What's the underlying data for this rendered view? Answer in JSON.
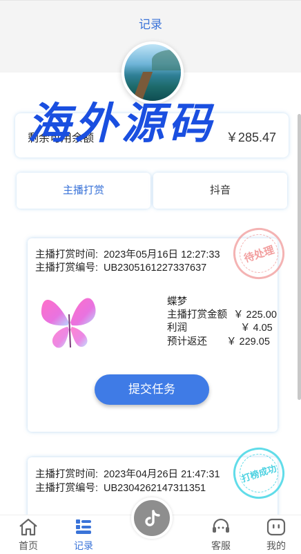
{
  "header": {
    "title": "记录"
  },
  "balance": {
    "label": "剩余可用余额",
    "value": "￥285.47"
  },
  "watermark": {
    "text": "海外源码"
  },
  "tabs": [
    {
      "label": "主播打赏",
      "active": true
    },
    {
      "label": "抖音",
      "active": false
    }
  ],
  "orders": [
    {
      "time_label": "主播打赏时间:",
      "time_value": "2023年05月16日 12:27:33",
      "no_label": "主播打赏编号:",
      "no_value": "UB2305161227337637",
      "stamp": "待处理",
      "product_name": "蝶梦",
      "details": [
        {
          "label": "主播打赏金额",
          "value": "￥ 225.00"
        },
        {
          "label": "利润",
          "value": "￥ 4.05"
        },
        {
          "label": "预计返还",
          "value": "￥ 229.05"
        }
      ],
      "button": "提交任务"
    },
    {
      "time_label": "主播打赏时间:",
      "time_value": "2023年04月26日 21:47:31",
      "no_label": "主播打赏编号:",
      "no_value": "UB2304262147311351",
      "stamp": "打榜成功"
    }
  ],
  "nav": {
    "home": "首页",
    "records": "记录",
    "service": "客服",
    "mine": "我的"
  },
  "colors": {
    "accent": "#3f7be6",
    "pending": "#ee8080",
    "success": "#2ccadc"
  }
}
